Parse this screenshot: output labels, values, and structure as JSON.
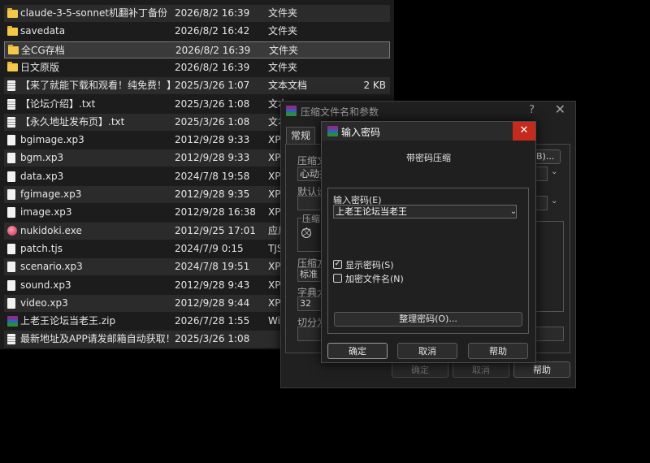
{
  "files": [
    {
      "name": "claude-3-5-sonnet机翻补丁备份",
      "date": "2026/8/2 16:39",
      "type": "文件夹",
      "size": "",
      "icon": "folder-icon"
    },
    {
      "name": "savedata",
      "date": "2026/8/2 16:42",
      "type": "文件夹",
      "size": "",
      "icon": "folder-icon"
    },
    {
      "name": "全CG存档",
      "date": "2026/8/2 16:39",
      "type": "文件夹",
      "size": "",
      "icon": "folder-icon"
    },
    {
      "name": "日文原版",
      "date": "2026/8/2 16:39",
      "type": "文件夹",
      "size": "",
      "icon": "folder-icon"
    },
    {
      "name": "【来了就能下载和观看！纯免费！】.txt",
      "date": "2025/3/26 1:07",
      "type": "文本文档",
      "size": "2 KB",
      "icon": "text-file-icon"
    },
    {
      "name": "【论坛介绍】.txt",
      "date": "2025/3/26 1:08",
      "type": "文本",
      "size": "",
      "icon": "text-file-icon"
    },
    {
      "name": "【永久地址发布页】.txt",
      "date": "2025/3/26 1:08",
      "type": "文本",
      "size": "",
      "icon": "text-file-icon"
    },
    {
      "name": "bgimage.xp3",
      "date": "2012/9/28 9:33",
      "type": "XP3",
      "size": "",
      "icon": "file-icon"
    },
    {
      "name": "bgm.xp3",
      "date": "2012/9/28 9:33",
      "type": "XP3",
      "size": "",
      "icon": "file-icon"
    },
    {
      "name": "data.xp3",
      "date": "2024/7/8 19:58",
      "type": "XP3",
      "size": "",
      "icon": "file-icon"
    },
    {
      "name": "fgimage.xp3",
      "date": "2012/9/28 9:35",
      "type": "XP3",
      "size": "",
      "icon": "file-icon"
    },
    {
      "name": "image.xp3",
      "date": "2012/9/28 16:38",
      "type": "XP3",
      "size": "",
      "icon": "file-icon"
    },
    {
      "name": "nukidoki.exe",
      "date": "2012/9/25 17:01",
      "type": "应用",
      "size": "",
      "icon": "app-icon"
    },
    {
      "name": "patch.tjs",
      "date": "2024/7/9 0:15",
      "type": "TJS",
      "size": "",
      "icon": "file-icon"
    },
    {
      "name": "scenario.xp3",
      "date": "2024/7/8 19:51",
      "type": "XP3",
      "size": "",
      "icon": "file-icon"
    },
    {
      "name": "sound.xp3",
      "date": "2012/9/28 9:43",
      "type": "XP3",
      "size": "",
      "icon": "file-icon"
    },
    {
      "name": "video.xp3",
      "date": "2012/9/28 9:44",
      "type": "XP3",
      "size": "",
      "icon": "file-icon"
    },
    {
      "name": "上老王论坛当老王.zip",
      "date": "2026/7/28 1:55",
      "type": "Win",
      "size": "",
      "icon": "winrar-archive-icon"
    },
    {
      "name": "最新地址及APP请发邮箱自动获取！！！....",
      "date": "2025/3/26 1:08",
      "type": "",
      "size": "",
      "icon": "text-file-icon"
    }
  ],
  "selected_index": 2,
  "archive_dialog": {
    "title": "压缩文件名和参数",
    "help_glyph": "?",
    "close_glyph": "✕",
    "tab_general": "常规",
    "label_archive_name": "压缩文",
    "archive_name_value": "心动拍",
    "browse_label": "(B)...",
    "label_default": "默认设",
    "label_format": "压缩文",
    "label_method": "压缩方",
    "method_value": "标准",
    "label_dict": "字典大",
    "dict_value": "32",
    "label_split": "切分为",
    "ok": "确定",
    "cancel": "取消",
    "help": "帮助"
  },
  "password_dialog": {
    "title": "输入密码",
    "close_glyph": "✕",
    "heading": "带密码压缩",
    "label_password": "输入密码(E)",
    "password_value": "上老王论坛当老王",
    "show_password": "显示密码(S)",
    "show_password_checked": true,
    "encrypt_names": "加密文件名(N)",
    "encrypt_names_checked": false,
    "organize": "整理密码(O)...",
    "ok": "确定",
    "cancel": "取消",
    "help": "帮助"
  }
}
